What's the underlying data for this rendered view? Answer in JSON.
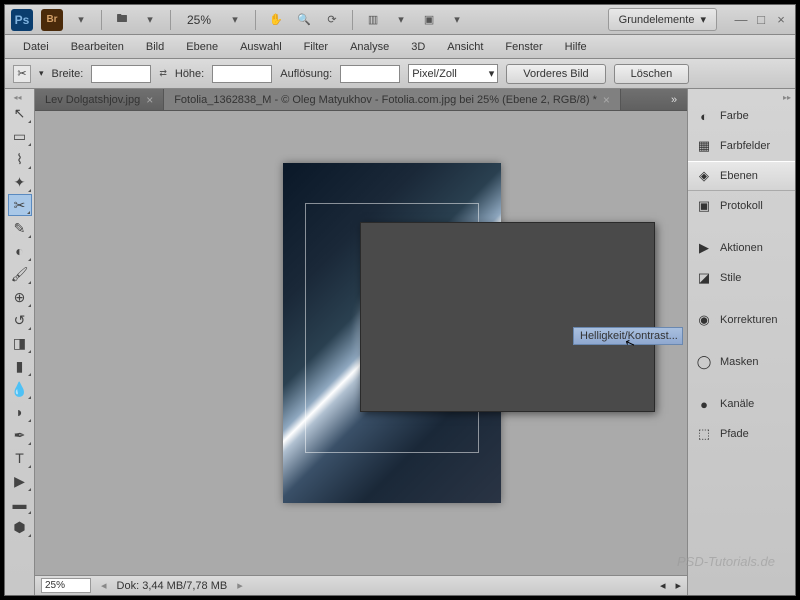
{
  "titlebar": {
    "zoom": "25%",
    "workspace": "Grundelemente"
  },
  "menu": [
    "Datei",
    "Bearbeiten",
    "Bild",
    "Ebene",
    "Auswahl",
    "Filter",
    "Analyse",
    "3D",
    "Ansicht",
    "Fenster",
    "Hilfe"
  ],
  "options": {
    "breite_lbl": "Breite:",
    "breite_val": "",
    "hoehe_lbl": "Höhe:",
    "hoehe_val": "",
    "aufl_lbl": "Auflösung:",
    "aufl_val": "",
    "unit": "Pixel/Zoll",
    "btn1": "Vorderes Bild",
    "btn2": "Löschen"
  },
  "tabs": [
    {
      "label": "Lev Dolgatshjov.jpg",
      "active": false
    },
    {
      "label": "Fotolia_1362838_M - © Oleg Matyukhov - Fotolia.com.jpg bei 25% (Ebene 2, RGB/8) *",
      "active": true
    }
  ],
  "panels": [
    {
      "name": "farbe",
      "label": "Farbe",
      "icon": "◐"
    },
    {
      "name": "farbfelder",
      "label": "Farbfelder",
      "icon": "▦"
    },
    {
      "name": "ebenen",
      "label": "Ebenen",
      "icon": "◈",
      "active": true
    },
    {
      "name": "protokoll",
      "label": "Protokoll",
      "icon": "▣"
    },
    {
      "name": "aktionen",
      "label": "Aktionen",
      "icon": "▶"
    },
    {
      "name": "stile",
      "label": "Stile",
      "icon": "◪"
    },
    {
      "name": "korrekturen",
      "label": "Korrekturen",
      "icon": "◉"
    },
    {
      "name": "masken",
      "label": "Masken",
      "icon": "◯"
    },
    {
      "name": "kanaele",
      "label": "Kanäle",
      "icon": "●"
    },
    {
      "name": "pfade",
      "label": "Pfade",
      "icon": "⬚"
    }
  ],
  "context_menu": {
    "item": "Helligkeit/Kontrast..."
  },
  "status": {
    "zoom": "25%",
    "doc": "Dok: 3,44 MB/7,78 MB"
  },
  "watermark": "PSD-Tutorials.de"
}
